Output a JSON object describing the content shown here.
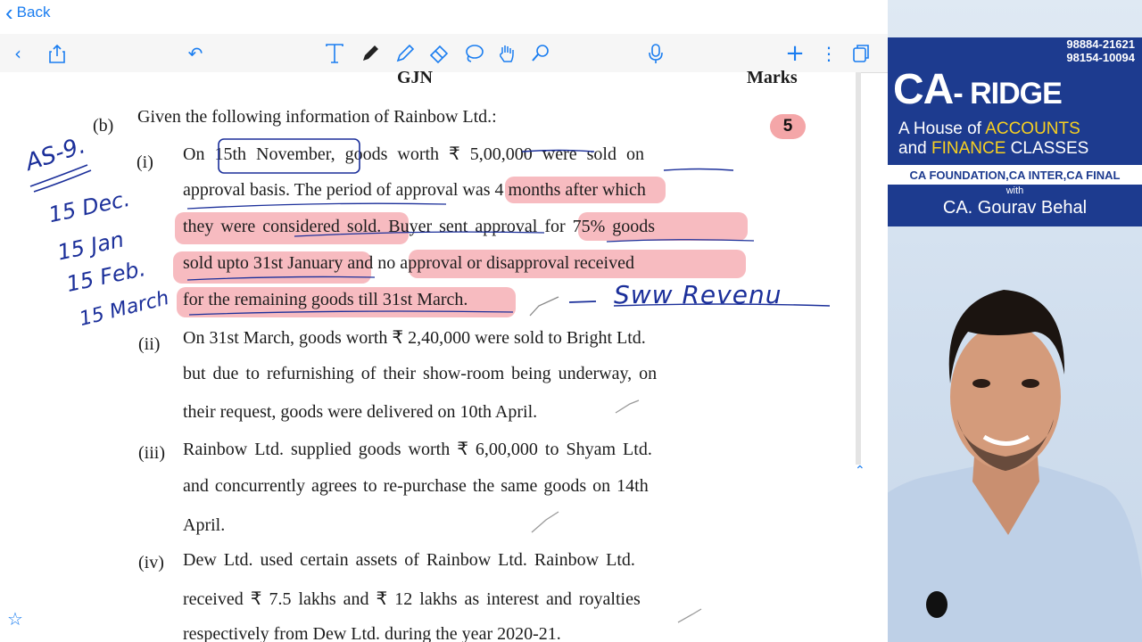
{
  "nav": {
    "back_label": "Back"
  },
  "toolbar": {
    "icons": [
      "chevron-left-icon",
      "share-icon",
      "undo-icon",
      "text-tool-icon",
      "pen-icon",
      "highlighter-icon",
      "eraser-icon",
      "lasso-icon",
      "hand-icon",
      "shape-icon",
      "microphone-icon",
      "add-icon",
      "more-icon",
      "pages-icon"
    ]
  },
  "document": {
    "header_left": "GJN",
    "header_right": "Marks",
    "marks": "5",
    "question_label": "(b)",
    "question_text": "Given the following information of Rainbow Ltd.:",
    "items": [
      {
        "num": "(i)",
        "lines": [
          "On 15th November, goods worth ₹ 5,00,000 were sold on",
          "approval basis. The period of approval was 4 months after which",
          "they were considered sold. Buyer sent approval for 75% goods",
          "sold upto 31st January and no approval or disapproval received",
          "for the remaining goods till 31st March."
        ]
      },
      {
        "num": "(ii)",
        "lines": [
          "On 31st March, goods worth ₹ 2,40,000 were sold to Bright Ltd.",
          "but due to refurnishing of their show-room being underway, on",
          "their request, goods were delivered on 10th April."
        ]
      },
      {
        "num": "(iii)",
        "lines": [
          "Rainbow Ltd. supplied goods worth ₹ 6,00,000 to Shyam Ltd.",
          "and concurrently agrees to re-purchase the same goods on 14th",
          "April."
        ]
      },
      {
        "num": "(iv)",
        "lines": [
          "Dew Ltd. used certain assets of Rainbow Ltd. Rainbow Ltd.",
          "received ₹ 7.5 lakhs and ₹ 12 lakhs as interest and royalties",
          "respectively from Dew Ltd. during the year 2020-21."
        ]
      }
    ]
  },
  "handwriting": {
    "as9": "AS-9.",
    "d1": "15 Dec.",
    "d2": "15 Jan",
    "d3": "15 Feb.",
    "d4": "15 March",
    "revenue": "Sww Revenu"
  },
  "brand": {
    "phone1": "98884-21621",
    "phone2": "98154-10094",
    "name_main": "CA",
    "name_rest": "- RIDGE",
    "tagline1_pre": "A House of ",
    "tagline1_hl": "ACCOUNTS",
    "tagline2_pre": "and ",
    "tagline2_hl": "FINANCE",
    "tagline2_post": " CLASSES",
    "courses": "CA FOUNDATION,CA INTER,CA FINAL",
    "with": "with",
    "teacher": "CA. Gourav Behal"
  },
  "colors": {
    "accent": "#1a7df0",
    "highlight": "#f07882",
    "ink": "#1b2f9a",
    "banner": "#1d3b8f"
  }
}
